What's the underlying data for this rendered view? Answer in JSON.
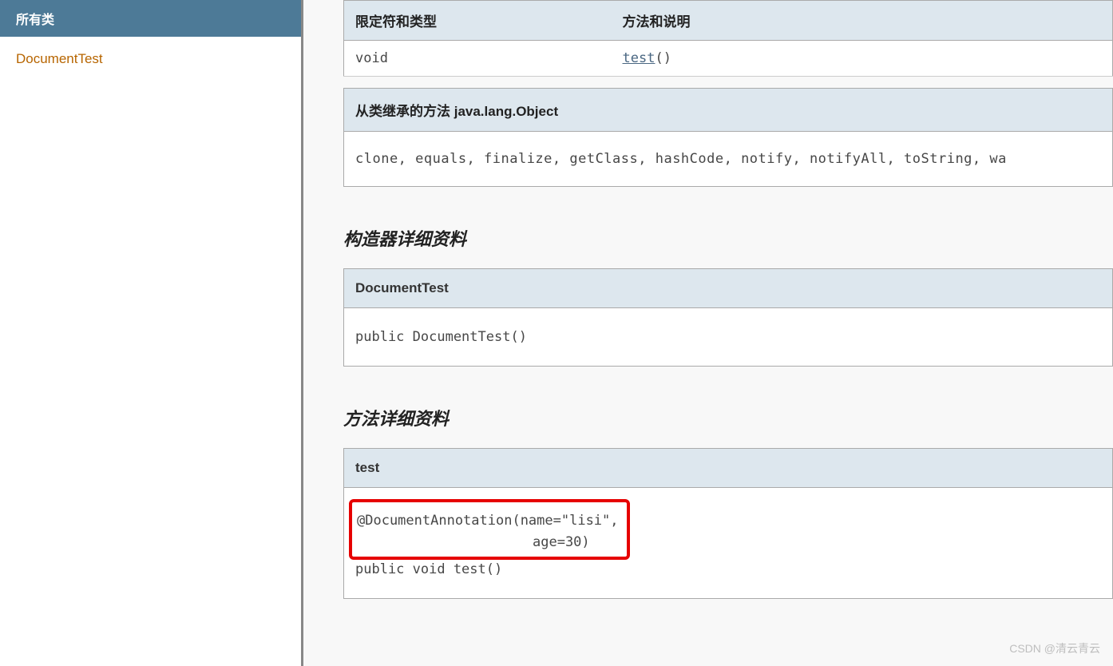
{
  "sidebar": {
    "header": "所有类",
    "items": [
      {
        "label": "DocumentTest"
      }
    ]
  },
  "methodSummary": {
    "col1": "限定符和类型",
    "col2": "方法和说明",
    "rows": [
      {
        "modifier": "void",
        "method": "test",
        "sig": "()"
      }
    ]
  },
  "inherited": {
    "title": "从类继承的方法 java.lang.Object",
    "methods": "clone, equals, finalize, getClass, hashCode, notify, notifyAll, toString, wa"
  },
  "constructor": {
    "sectionTitle": "构造器详细资料",
    "name": "DocumentTest",
    "signature": "public DocumentTest()"
  },
  "methodDetail": {
    "sectionTitle": "方法详细资料",
    "name": "test",
    "annotationLine1": "@DocumentAnnotation(name=\"lisi\",",
    "annotationLine2": "age=30)",
    "signature": "public void test()"
  },
  "watermark": "CSDN @清云青云"
}
